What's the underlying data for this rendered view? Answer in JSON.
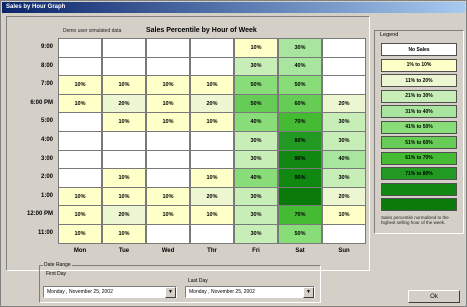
{
  "window": {
    "title": "Sales by Hour Graph"
  },
  "chart": {
    "demo_label": "Demo user simulated data",
    "title": "Sales Percentile by Hour of Week"
  },
  "hours": [
    "9:00",
    "8:00",
    "7:00",
    "6:00 PM",
    "5:00",
    "4:00",
    "3:00",
    "2:00",
    "1:00",
    "12:00 PM",
    "11:00"
  ],
  "days": [
    "Mon",
    "Tue",
    "Wed",
    "Thr",
    "Fri",
    "Sat",
    "Sun"
  ],
  "grid": [
    [
      {
        "t": "",
        "c": "#ffffff"
      },
      {
        "t": "",
        "c": "#ffffff"
      },
      {
        "t": "",
        "c": "#ffffff"
      },
      {
        "t": "",
        "c": "#ffffff"
      },
      {
        "t": "10%",
        "c": "#ffffc8"
      },
      {
        "t": "30%",
        "c": "#a8e6a0"
      },
      {
        "t": "",
        "c": "#ffffff"
      }
    ],
    [
      {
        "t": "",
        "c": "#ffffff"
      },
      {
        "t": "",
        "c": "#ffffff"
      },
      {
        "t": "",
        "c": "#ffffff"
      },
      {
        "t": "",
        "c": "#ffffff"
      },
      {
        "t": "30%",
        "c": "#c8eeb8"
      },
      {
        "t": "40%",
        "c": "#a8e6a0"
      },
      {
        "t": "",
        "c": "#ffffff"
      }
    ],
    [
      {
        "t": "10%",
        "c": "#ffffc8"
      },
      {
        "t": "10%",
        "c": "#ffffc8"
      },
      {
        "t": "10%",
        "c": "#ffffc8"
      },
      {
        "t": "10%",
        "c": "#ffffc8"
      },
      {
        "t": "50%",
        "c": "#88dd78"
      },
      {
        "t": "50%",
        "c": "#88dd78"
      },
      {
        "t": "",
        "c": "#ffffff"
      }
    ],
    [
      {
        "t": "10%",
        "c": "#ffffc8"
      },
      {
        "t": "20%",
        "c": "#ecf6d0"
      },
      {
        "t": "10%",
        "c": "#ffffc8"
      },
      {
        "t": "20%",
        "c": "#ecf6d0"
      },
      {
        "t": "50%",
        "c": "#66cc55"
      },
      {
        "t": "60%",
        "c": "#66cc55"
      },
      {
        "t": "20%",
        "c": "#ecf6d0"
      }
    ],
    [
      {
        "t": "",
        "c": "#ffffff"
      },
      {
        "t": "10%",
        "c": "#ffffc8"
      },
      {
        "t": "10%",
        "c": "#ffffc8"
      },
      {
        "t": "10%",
        "c": "#ffffc8"
      },
      {
        "t": "40%",
        "c": "#88dd78"
      },
      {
        "t": "70%",
        "c": "#44bb33"
      },
      {
        "t": "30%",
        "c": "#c8eeb8"
      }
    ],
    [
      {
        "t": "",
        "c": "#ffffff"
      },
      {
        "t": "",
        "c": "#ffffff"
      },
      {
        "t": "",
        "c": "#ffffff"
      },
      {
        "t": "",
        "c": "#ffffff"
      },
      {
        "t": "30%",
        "c": "#c8eeb8"
      },
      {
        "t": "80%",
        "c": "#229922"
      },
      {
        "t": "30%",
        "c": "#c8eeb8"
      }
    ],
    [
      {
        "t": "",
        "c": "#ffffff"
      },
      {
        "t": "",
        "c": "#ffffff"
      },
      {
        "t": "",
        "c": "#ffffff"
      },
      {
        "t": "",
        "c": "#ffffff"
      },
      {
        "t": "30%",
        "c": "#c8eeb8"
      },
      {
        "t": "90%",
        "c": "#118811"
      },
      {
        "t": "40%",
        "c": "#a8e6a0"
      }
    ],
    [
      {
        "t": "",
        "c": "#ffffff"
      },
      {
        "t": "10%",
        "c": "#ffffc8"
      },
      {
        "t": "",
        "c": "#ffffff"
      },
      {
        "t": "10%",
        "c": "#ffffc8"
      },
      {
        "t": "40%",
        "c": "#88dd78"
      },
      {
        "t": "90%",
        "c": "#118811"
      },
      {
        "t": "30%",
        "c": "#c8eeb8"
      }
    ],
    [
      {
        "t": "10%",
        "c": "#ffffc8"
      },
      {
        "t": "10%",
        "c": "#ffffc8"
      },
      {
        "t": "10%",
        "c": "#ffffc8"
      },
      {
        "t": "20%",
        "c": "#ecf6d0"
      },
      {
        "t": "30%",
        "c": "#c8eeb8"
      },
      {
        "t": "",
        "c": "#0a7a0a"
      },
      {
        "t": "20%",
        "c": "#ecf6d0"
      }
    ],
    [
      {
        "t": "10%",
        "c": "#ffffc8"
      },
      {
        "t": "20%",
        "c": "#ecf6d0"
      },
      {
        "t": "10%",
        "c": "#ffffc8"
      },
      {
        "t": "10%",
        "c": "#ffffc8"
      },
      {
        "t": "30%",
        "c": "#c8eeb8"
      },
      {
        "t": "70%",
        "c": "#44bb33"
      },
      {
        "t": "10%",
        "c": "#ffffc8"
      }
    ],
    [
      {
        "t": "10%",
        "c": "#ffffc8"
      },
      {
        "t": "10%",
        "c": "#ffffc8"
      },
      {
        "t": "",
        "c": "#ffffff"
      },
      {
        "t": "",
        "c": "#ffffff"
      },
      {
        "t": "30%",
        "c": "#c8eeb8"
      },
      {
        "t": "50%",
        "c": "#88dd78"
      },
      {
        "t": "",
        "c": "#ffffff"
      }
    ]
  ],
  "legend": {
    "title": "Legend",
    "items": [
      {
        "label": "No Sales",
        "color": "#ffffff"
      },
      {
        "label": "1% to 10%",
        "color": "#ffffc8"
      },
      {
        "label": "11% to 20%",
        "color": "#ecf6d0"
      },
      {
        "label": "21% to 30%",
        "color": "#c8eeb8"
      },
      {
        "label": "31% to 40%",
        "color": "#a8e6a0"
      },
      {
        "label": "41% to 50%",
        "color": "#88dd78"
      },
      {
        "label": "51% to 60%",
        "color": "#66cc55"
      },
      {
        "label": "61% to 70%",
        "color": "#44bb33"
      },
      {
        "label": "71% to 80%",
        "color": "#229922"
      },
      {
        "label": "",
        "color": "#118811"
      },
      {
        "label": "",
        "color": "#0a7a0a"
      }
    ],
    "note": "Sales percentile normalized to the highest selling hour of the week."
  },
  "date_range": {
    "title": "Date Range",
    "first_label": "First Day",
    "first_value": "Monday , November 25, 2002",
    "last_label": "Last Day",
    "last_value": "Monday , November 25, 2002"
  },
  "ok_label": "Ok"
}
